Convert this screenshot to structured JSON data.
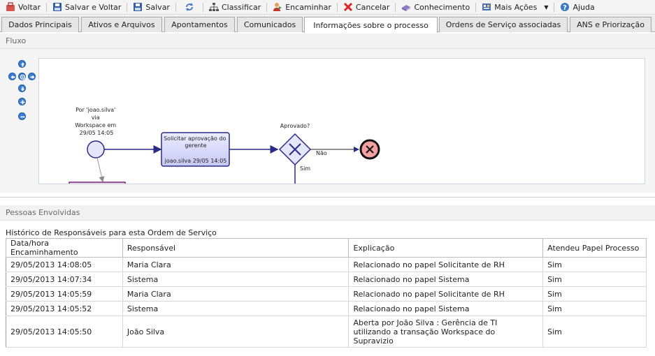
{
  "toolbar": {
    "back": "Voltar",
    "save_back": "Salvar e Voltar",
    "save": "Salvar",
    "classify": "Classificar",
    "forward": "Encaminhar",
    "cancel": "Cancelar",
    "knowledge": "Conhecimento",
    "more_actions": "Mais Ações",
    "help": "Ajuda"
  },
  "tabs": [
    {
      "label": "Dados Principais"
    },
    {
      "label": "Ativos e Arquivos"
    },
    {
      "label": "Apontamentos"
    },
    {
      "label": "Comunicados"
    },
    {
      "label": "Informações sobre o processo"
    },
    {
      "label": "Ordens de Serviço associadas"
    },
    {
      "label": "ANS e Priorização"
    }
  ],
  "active_tab": 4,
  "flow": {
    "title": "Fluxo",
    "start_label_lines": [
      "Por 'joao.silva'",
      "via",
      "Workspace em",
      "29/05 14:05"
    ],
    "task_label_lines": [
      "Solicitar aprovação do",
      "gerente"
    ],
    "task_assignee": "joao.silva 29/05 14:05",
    "gateway_label": "Aprovado?",
    "no_label": "Não",
    "yes_label": "Sim"
  },
  "people": {
    "title": "Pessoas Envolvidas"
  },
  "history": {
    "title": "Histórico de Responsáveis para esta Ordem de Serviço",
    "columns": [
      "Data/hora Encaminhamento",
      "Responsável",
      "Explicação",
      "Atendeu Papel Processo"
    ],
    "rows": [
      {
        "date": "29/05/2013 14:08:05",
        "responsible": "Maria Clara",
        "explanation": "Relacionado no papel Solicitante de RH",
        "attended": "Sim"
      },
      {
        "date": "29/05/2013 14:07:34",
        "responsible": "Sistema",
        "explanation": "Relacionado no papel Sistema",
        "attended": "Sim"
      },
      {
        "date": "29/05/2013 14:05:59",
        "responsible": "Maria Clara",
        "explanation": "Relacionado no papel Solicitante de RH",
        "attended": "Sim"
      },
      {
        "date": "29/05/2013 14:05:52",
        "responsible": "Sistema",
        "explanation": "Relacionado no papel Sistema",
        "attended": "Sim"
      },
      {
        "date": "29/05/2013 14:05:50",
        "responsible": "João Silva",
        "explanation_lines": [
          "Aberta por João Silva : Gerência de TI",
          "utilizando a transação Workspace do",
          "Supravizio"
        ],
        "attended": "Sim"
      }
    ]
  },
  "colors": {
    "flow_line": "#2a2a8a",
    "task_fill": "#d9d9ff",
    "end_fill": "#f08080",
    "nav_blue": "#3c7ed0"
  }
}
